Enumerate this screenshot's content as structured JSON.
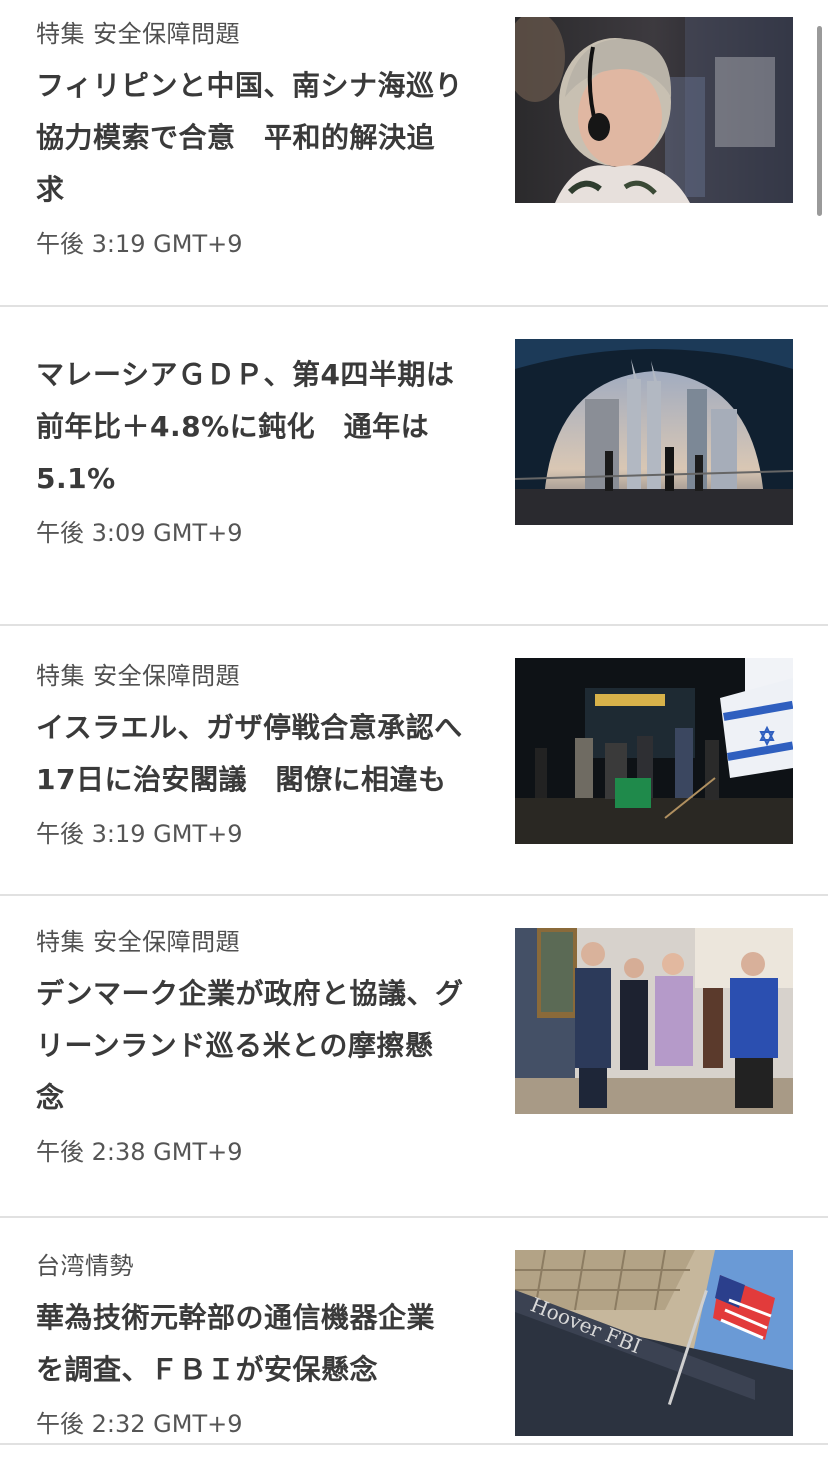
{
  "articles": [
    {
      "kicker": "特集 安全保障問題",
      "headline_lines": [
        "フィリピンと中国、南シナ海巡り",
        "協力模索で合意　平和的解決追",
        "求"
      ],
      "time": "午後 3:19 GMT+9",
      "image": "woman-with-headphones-photo"
    },
    {
      "kicker": "",
      "headline_lines": [
        "マレーシアＧＤＰ、第4四半期は",
        "前年比＋4.8%に鈍化　通年は",
        "5.1%"
      ],
      "time": "午後 3:09 GMT+9",
      "image": "kuala-lumpur-skyline-photo"
    },
    {
      "kicker": "特集 安全保障問題",
      "headline_lines": [
        "イスラエル、ガザ停戦合意承認へ",
        "17日に治安閣議　閣僚に相違も"
      ],
      "time": "午後 3:19 GMT+9",
      "image": "israel-protest-night-photo"
    },
    {
      "kicker": "特集 安全保障問題",
      "headline_lines": [
        "デンマーク企業が政府と協議、グ",
        "リーンランド巡る米との摩擦懸",
        "念"
      ],
      "time": "午後 2:38 GMT+9",
      "image": "officials-walking-corridor-photo"
    },
    {
      "kicker": "台湾情勢",
      "headline_lines": [
        "華為技術元幹部の通信機器企業",
        "を調査、ＦＢＩが安保懸念"
      ],
      "time": "午後 2:32 GMT+9",
      "image": "fbi-building-flag-photo",
      "image_sign_text": "Hoover FBI"
    }
  ]
}
